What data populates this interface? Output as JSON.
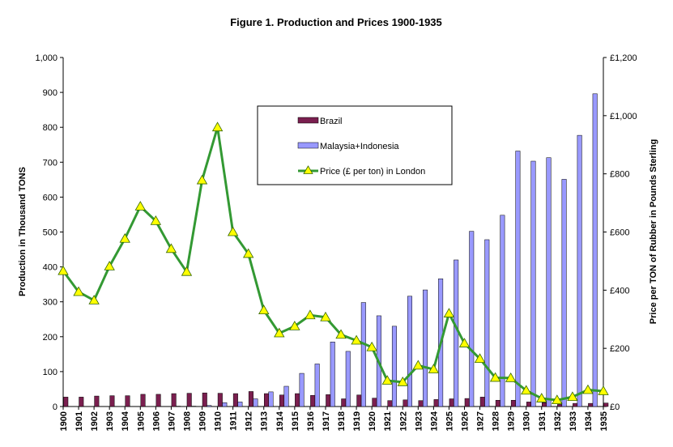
{
  "chart_data": {
    "type": "bar",
    "title": "Figure 1. Production and Prices 1900-1935",
    "ylabel": "Production in Thousand TONS",
    "y2label": "Price per TON of Rubber in Pounds Sterling",
    "ylim": [
      0,
      1000
    ],
    "y2lim": [
      0,
      1200
    ],
    "y_ticks": [
      "0",
      "100",
      "200",
      "300",
      "400",
      "500",
      "600",
      "700",
      "800",
      "900",
      "1,000"
    ],
    "y2_ticks": [
      "£0",
      "£200",
      "£400",
      "£600",
      "£800",
      "£1,000",
      "£1,200"
    ],
    "legend_position": "top-center",
    "grid": false,
    "categories": [
      "1900",
      "1901",
      "1902",
      "1903",
      "1904",
      "1905",
      "1906",
      "1907",
      "1908",
      "1909",
      "1910",
      "1911",
      "1912",
      "1913",
      "1914",
      "1915",
      "1916",
      "1917",
      "1918",
      "1919",
      "1920",
      "1921",
      "1922",
      "1923",
      "1924",
      "1925",
      "1926",
      "1927",
      "1928",
      "1929",
      "1930",
      "1931",
      "1932",
      "1933",
      "1934",
      "1935"
    ],
    "series": [
      {
        "name": "Brazil",
        "kind": "bar",
        "axis": "left",
        "color": "#7a1f4f",
        "values": [
          27,
          27,
          30,
          31,
          31,
          35,
          35,
          37,
          38,
          39,
          38,
          37,
          43,
          37,
          33,
          37,
          32,
          34,
          22,
          33,
          24,
          17,
          19,
          17,
          20,
          22,
          23,
          27,
          18,
          18,
          13,
          11,
          6,
          9,
          9,
          10
        ]
      },
      {
        "name": "Malaysia+Indonesia",
        "kind": "bar",
        "axis": "left",
        "color": "#9999ff",
        "values": [
          0,
          0,
          0,
          0,
          0,
          0,
          0,
          1,
          1,
          3,
          11,
          13,
          22,
          42,
          58,
          95,
          122,
          185,
          158,
          298,
          260,
          230,
          316,
          334,
          366,
          420,
          502,
          478,
          548,
          732,
          703,
          713,
          651,
          777,
          896,
          0
        ]
      },
      {
        "name": "Price (£ per ton) in London",
        "kind": "line",
        "axis": "right",
        "color": "#339933",
        "marker_color": "#ffff00",
        "values": [
          466,
          394,
          365,
          482,
          577,
          688,
          638,
          542,
          463,
          778,
          960,
          600,
          525,
          331,
          252,
          276,
          314,
          307,
          247,
          227,
          204,
          89,
          84,
          141,
          128,
          320,
          217,
          164,
          99,
          98,
          55,
          28,
          22,
          33,
          57,
          53
        ]
      }
    ]
  }
}
